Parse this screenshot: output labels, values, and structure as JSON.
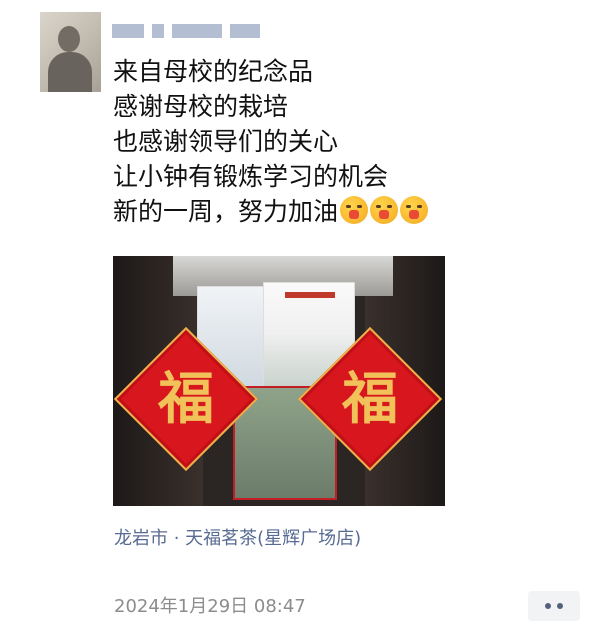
{
  "post": {
    "lines": [
      "来自母校的纪念品",
      "感谢母校的栽培",
      "也感谢领导们的关心",
      "让小钟有锻炼学习的机会",
      "新的一周，努力加油"
    ],
    "emoji_name": "smiling-face-with-hand-over-mouth",
    "emoji_count": 3,
    "location": "龙岩市 · 天福茗茶(星辉广场店)",
    "timestamp": "2024年1月29日 08:47"
  },
  "photo": {
    "fu_character": "福"
  },
  "colors": {
    "location_link": "#586b93",
    "timestamp": "#8c8c8c",
    "fu_red": "#d8161e",
    "fu_gold": "#f2c25a"
  }
}
